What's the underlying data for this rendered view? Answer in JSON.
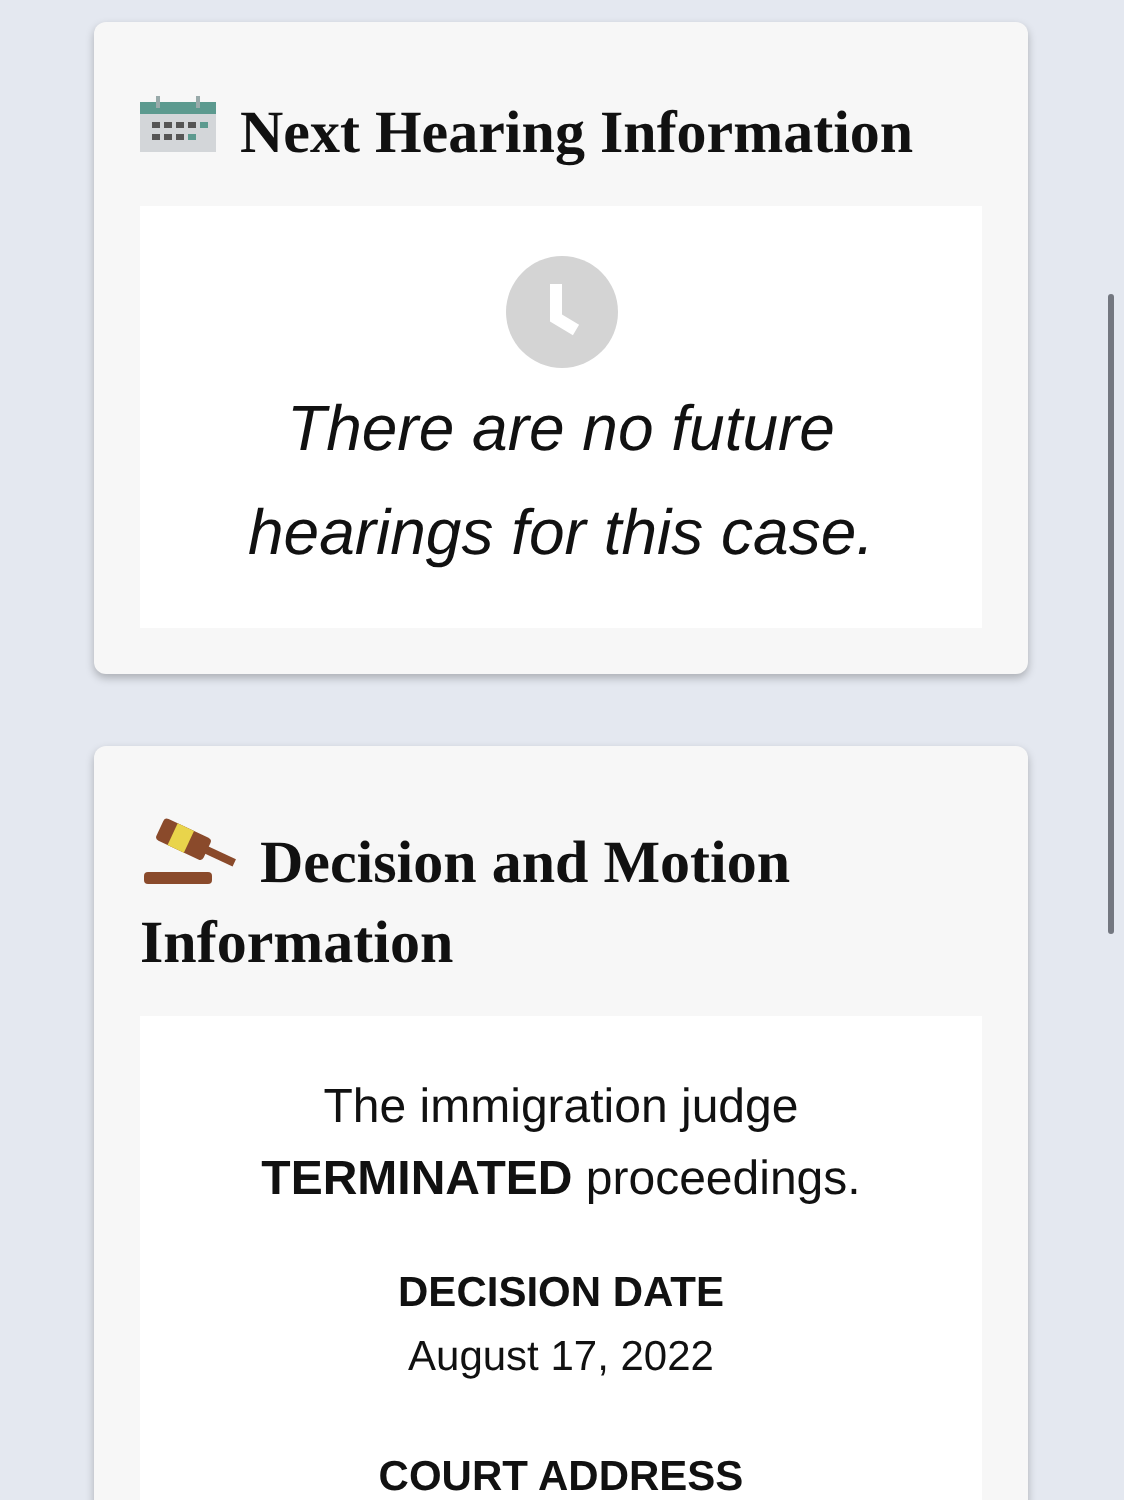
{
  "cards": [
    {
      "kind": "hearing",
      "title": "Next Hearing Information",
      "message": "There are no future hearings for this case."
    },
    {
      "kind": "decision",
      "title": "Decision and Motion Information",
      "summary": "The immigration judge **TERMINATED** proceedings.",
      "fields": [
        {
          "label": "DECISION DATE",
          "value": "August 17, 2022"
        },
        {
          "label": "COURT ADDRESS"
        }
      ]
    }
  ]
}
